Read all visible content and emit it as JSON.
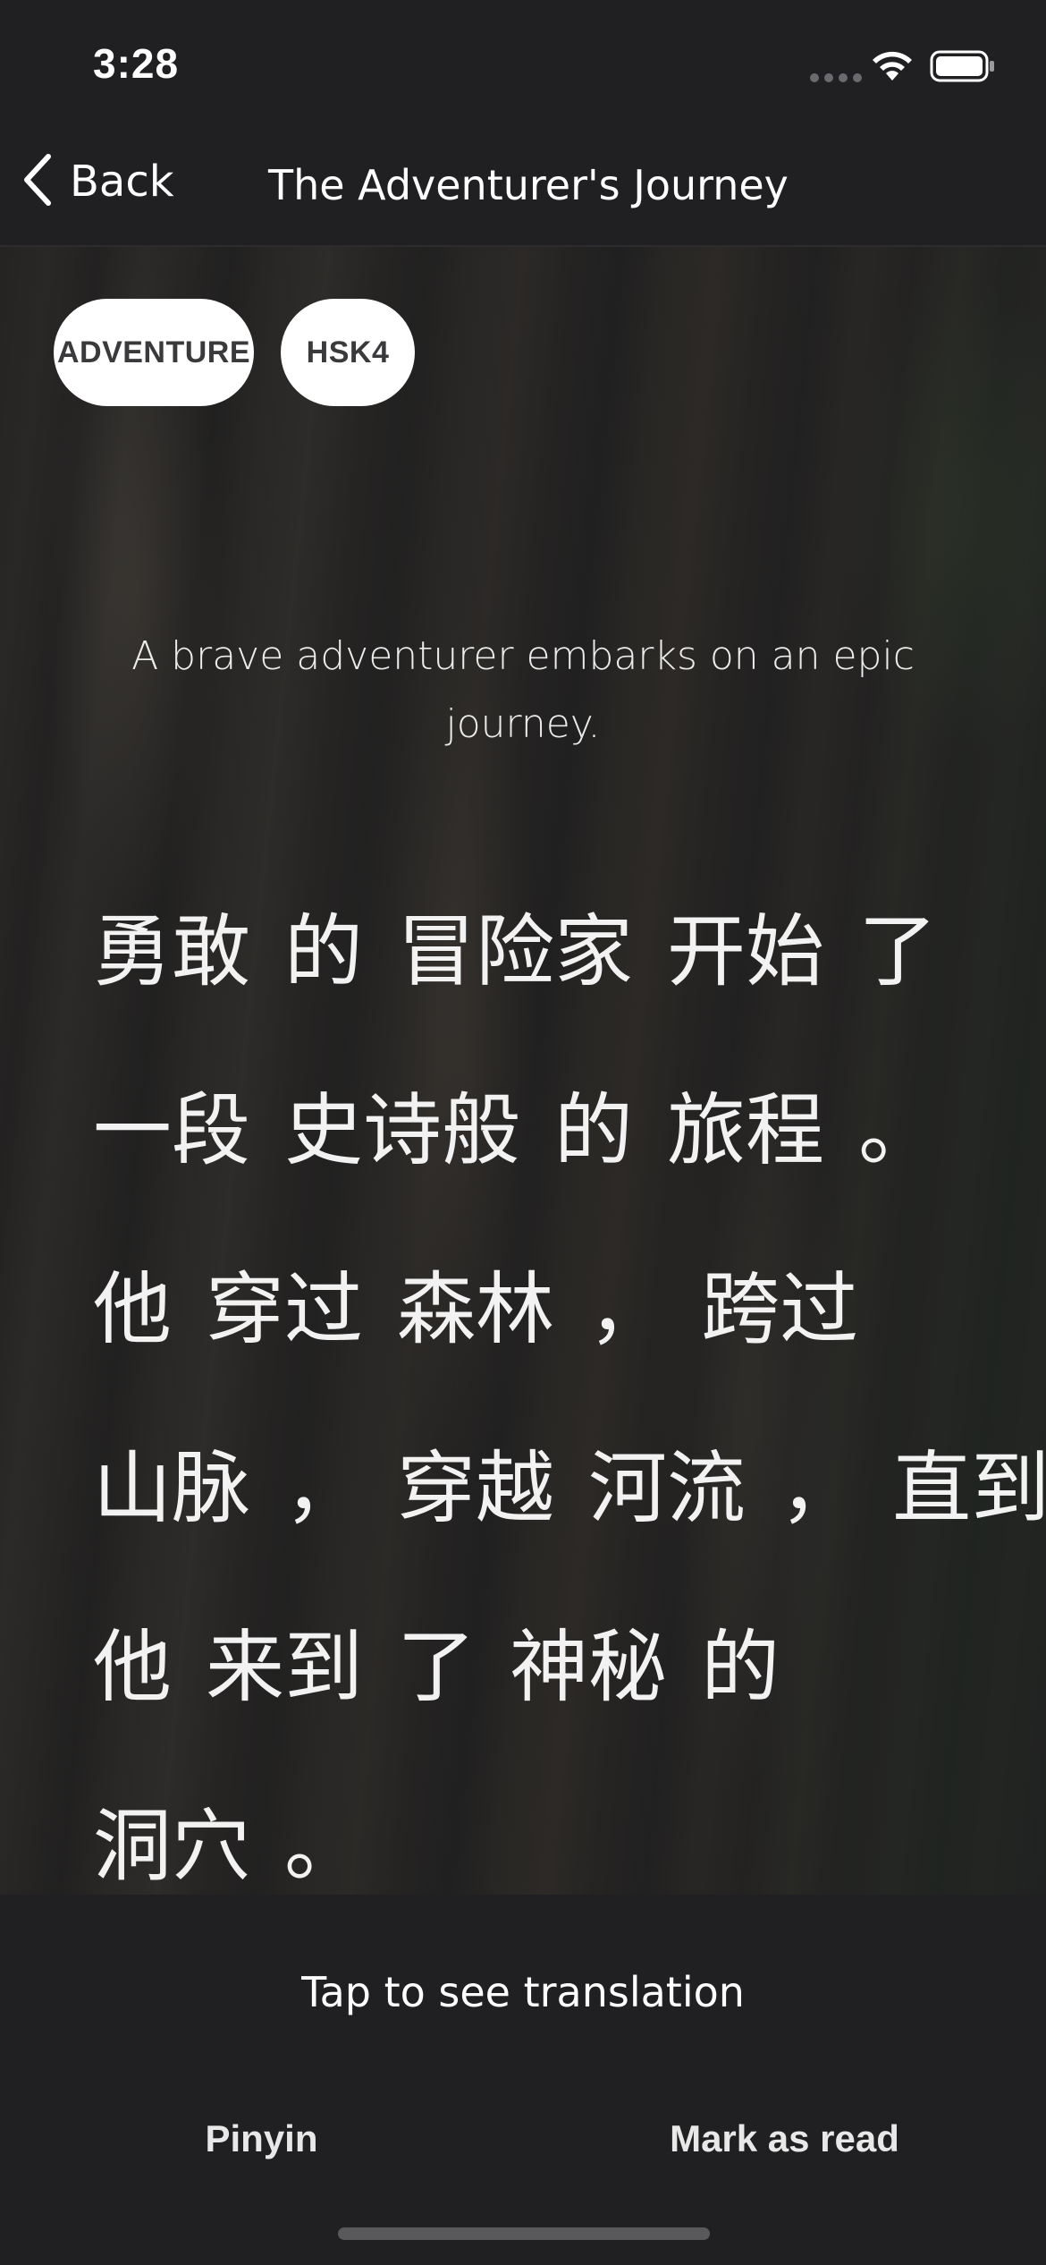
{
  "status_bar": {
    "time": "3:28",
    "wifi_icon": "wifi-icon",
    "battery_icon": "battery-icon"
  },
  "nav": {
    "back_label": "Back",
    "back_icon": "chevron-left-icon",
    "title": "The Adventurer's Journey"
  },
  "tags": [
    "ADVENTURE",
    "HSK4"
  ],
  "subtitle": "A brave adventurer embarks on an epic journey.",
  "story": {
    "lines": [
      [
        "勇敢",
        "的",
        "冒险家",
        "开始",
        "了"
      ],
      [
        "一段",
        "史诗般",
        "的",
        "旅程",
        "。"
      ],
      [
        "他",
        "穿过",
        "森林",
        "，",
        "跨过"
      ],
      [
        "山脉",
        "，",
        "穿越",
        "河流",
        "，",
        "直到"
      ],
      [
        "他",
        "来到",
        "了",
        "神秘",
        "的"
      ],
      [
        "洞穴",
        "。"
      ]
    ]
  },
  "bottom": {
    "translate_hint": "Tap to see translation",
    "pinyin_label": "Pinyin",
    "mark_read_label": "Mark as read"
  },
  "colors": {
    "background": "#202022",
    "tag_background": "#ffffff",
    "tag_text": "#3a3a3c",
    "text": "#ffffff"
  }
}
